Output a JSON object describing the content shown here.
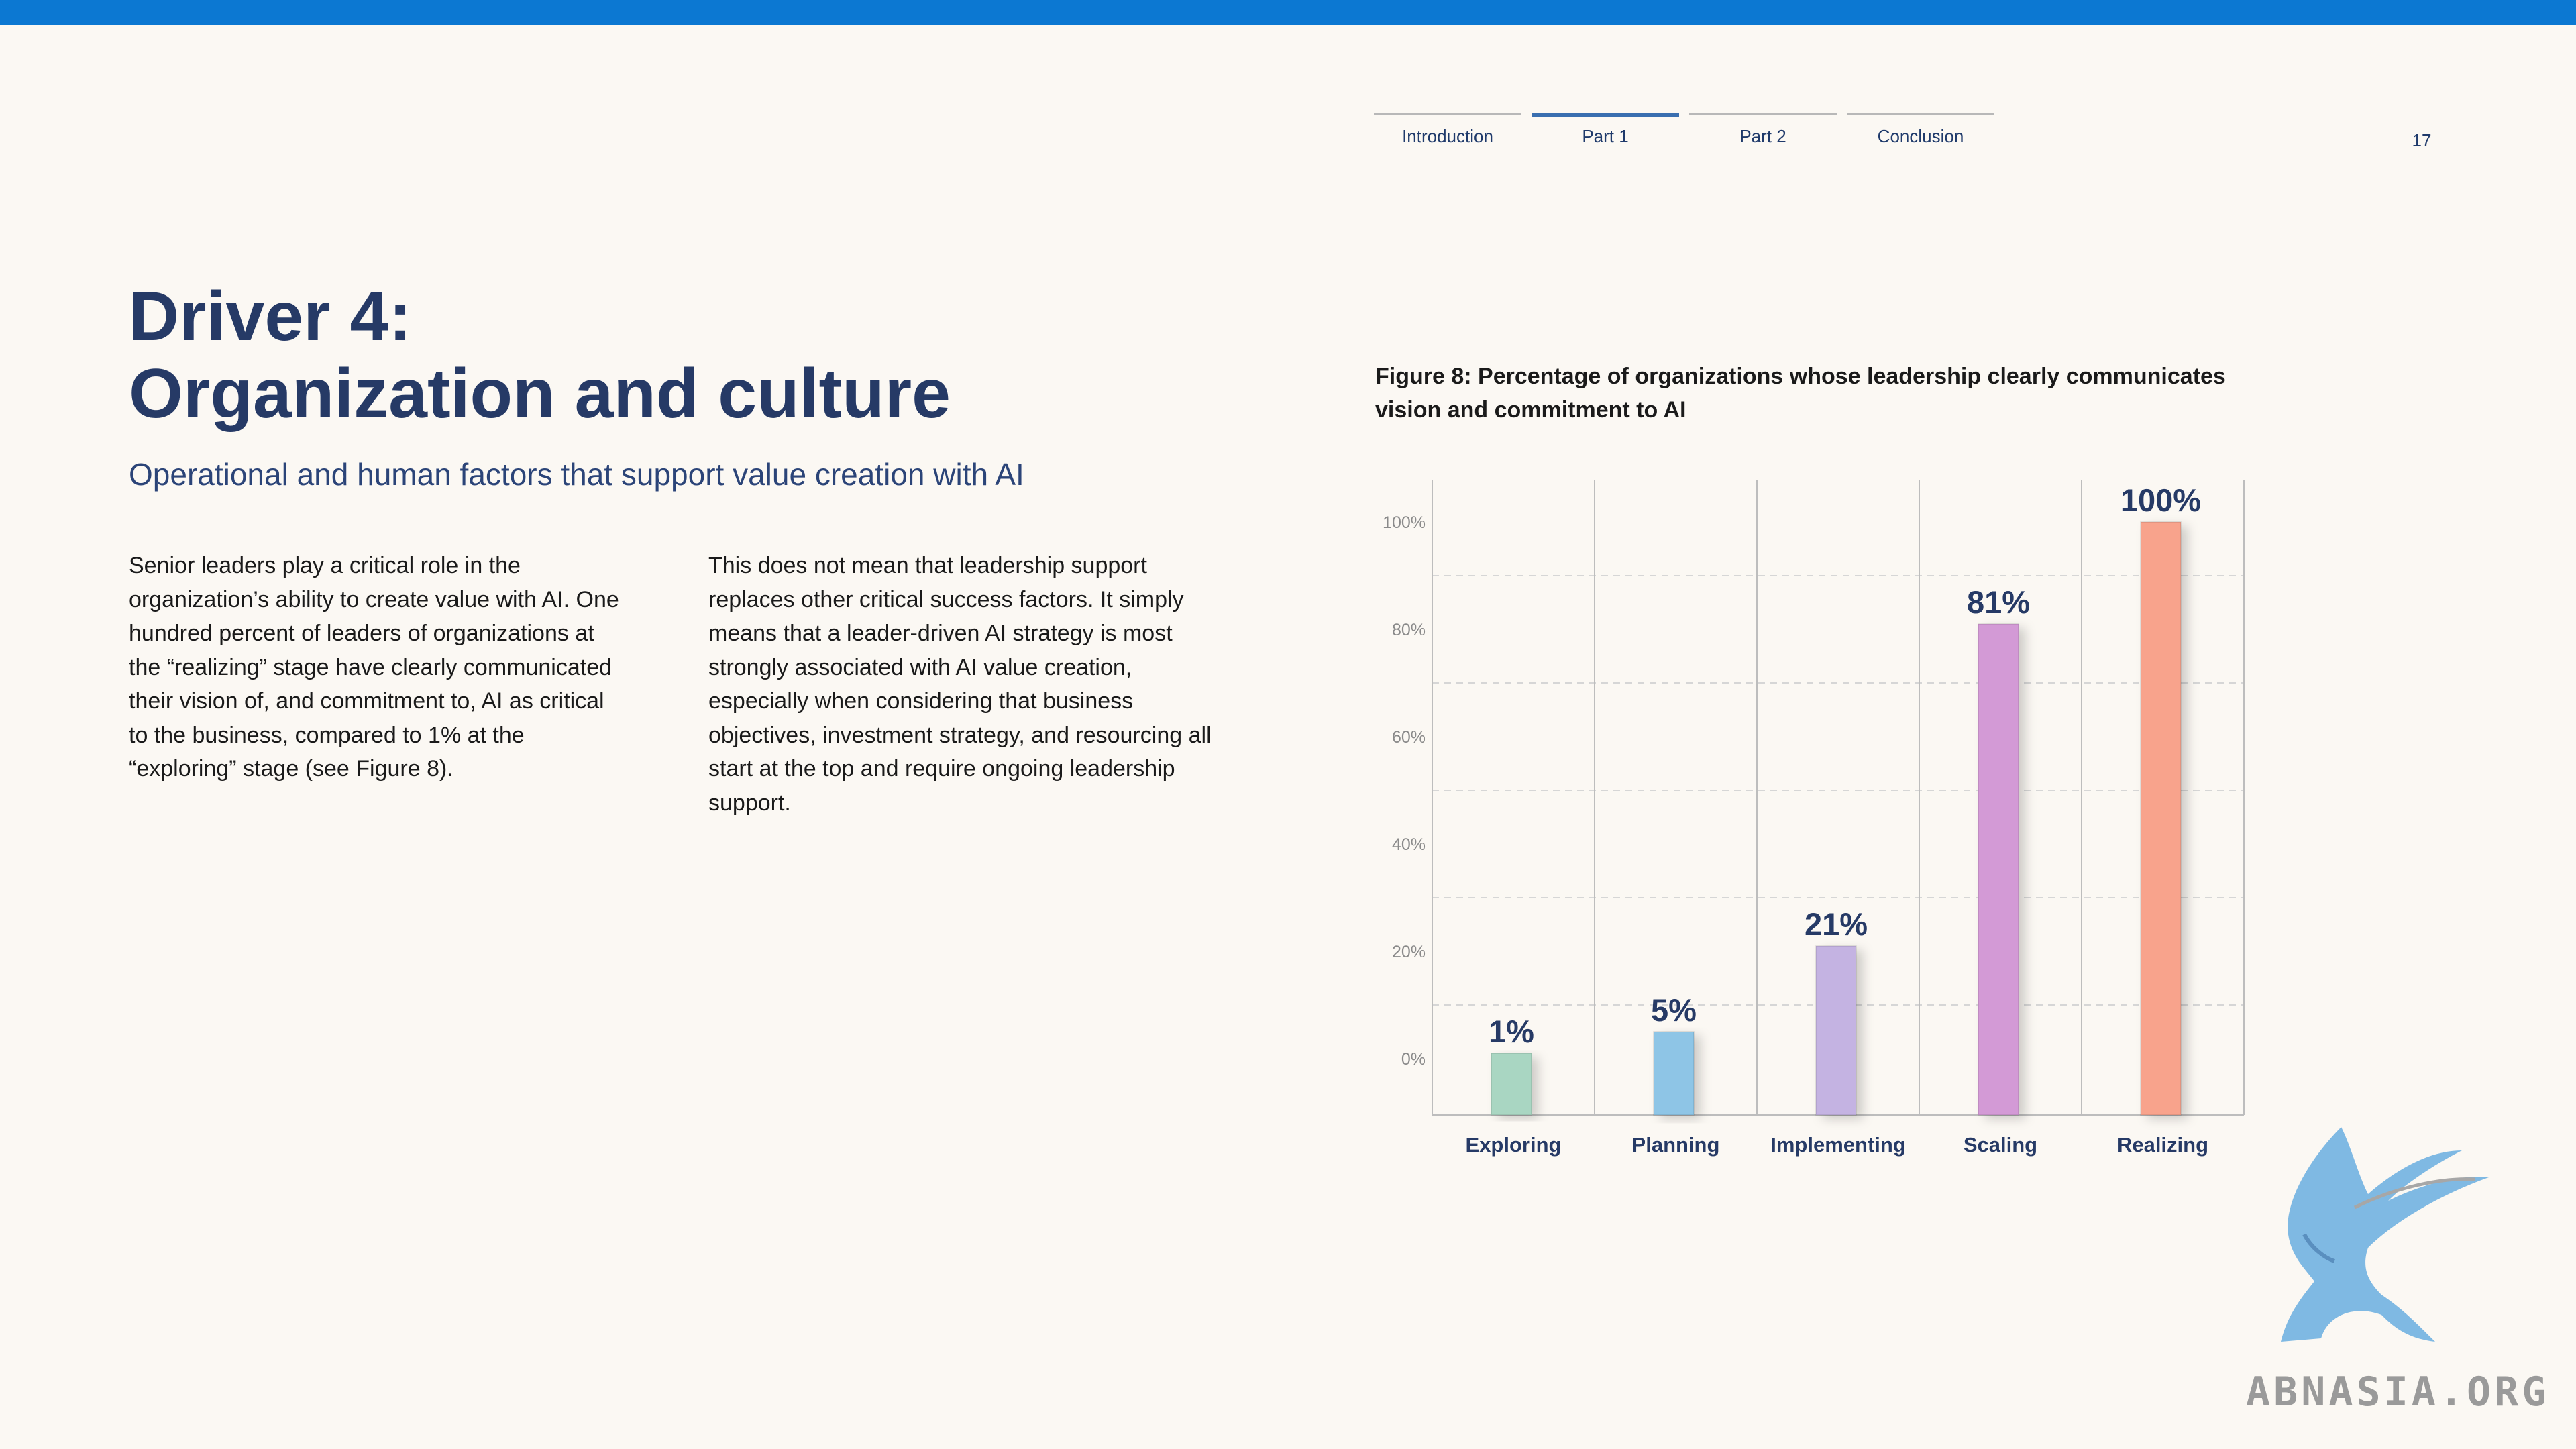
{
  "nav": {
    "items": [
      "Introduction",
      "Part 1",
      "Part 2",
      "Conclusion"
    ],
    "active_index": 1,
    "page_number": "17"
  },
  "heading": {
    "line1": "Driver 4:",
    "line2": "Organization and culture",
    "subtitle": "Operational and human factors that support value creation with AI"
  },
  "body": {
    "col1": "Senior leaders play a critical role in the organization’s ability to create value with AI. One hundred percent of leaders of organizations at the “realizing” stage have clearly communicated their vision of, and commitment to, AI as critical to the business, compared to 1% at the “exploring” stage (see Figure 8).",
    "col2": "This does not mean that leadership support replaces other critical success factors. It simply means that a leader-driven AI strategy is most strongly associated with AI value creation, especially when considering that business objectives, investment strategy, and resourcing all start at the top and require ongoing leadership support."
  },
  "figure": {
    "caption": "Figure 8: Percentage of organizations whose leadership clearly communicates vision and commitment to AI"
  },
  "chart_data": {
    "type": "bar",
    "title": "Figure 8: Percentage of organizations whose leadership clearly communicates vision and commitment to AI",
    "categories": [
      "Exploring",
      "Planning",
      "Implementing",
      "Scaling",
      "Realizing"
    ],
    "values": [
      1,
      5,
      21,
      81,
      100
    ],
    "value_labels": [
      "1%",
      "5%",
      "21%",
      "81%",
      "100%"
    ],
    "colors": [
      "#A9D6C2",
      "#8EC5E6",
      "#C4B3E2",
      "#D39AD6",
      "#F8A38C"
    ],
    "yticks": [
      0,
      20,
      40,
      60,
      80,
      100
    ],
    "ytick_labels": [
      "0%",
      "20%",
      "40%",
      "60%",
      "80%",
      "100%"
    ],
    "ylim": [
      0,
      100
    ],
    "grid": true,
    "xlabel": "",
    "ylabel": ""
  },
  "logo": {
    "text": "ABNASIA.ORG"
  }
}
